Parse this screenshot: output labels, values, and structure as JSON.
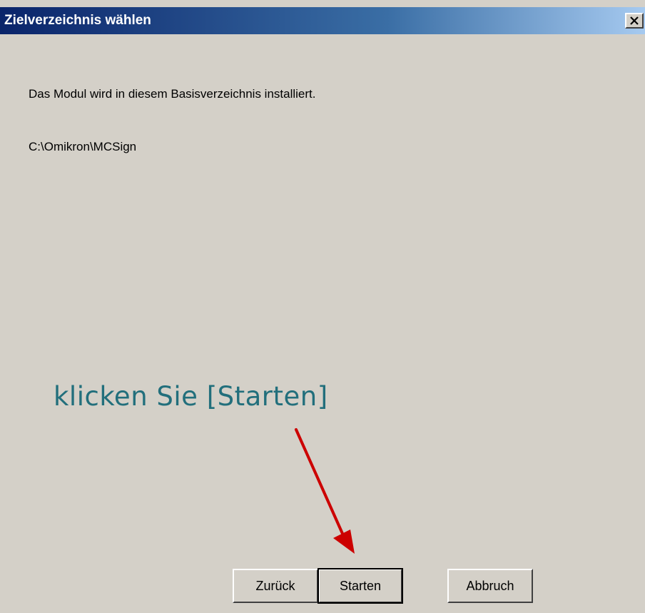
{
  "window": {
    "title": "Zielverzeichnis wählen",
    "close_label": "X"
  },
  "content": {
    "message": "Das Modul wird in diesem Basisverzeichnis installiert.",
    "install_path": "C:\\Omikron\\MCSign"
  },
  "annotation": {
    "text": "klicken Sie [Starten]",
    "text_color": "#226f7c",
    "arrow_color": "#cc0000"
  },
  "buttons": {
    "back_label": "Zurück",
    "start_label": "Starten",
    "cancel_label": "Abbruch"
  },
  "colors": {
    "titlebar_start": "#0a246a",
    "titlebar_end": "#a6caf0",
    "dialog_background": "#d4d0c8"
  }
}
